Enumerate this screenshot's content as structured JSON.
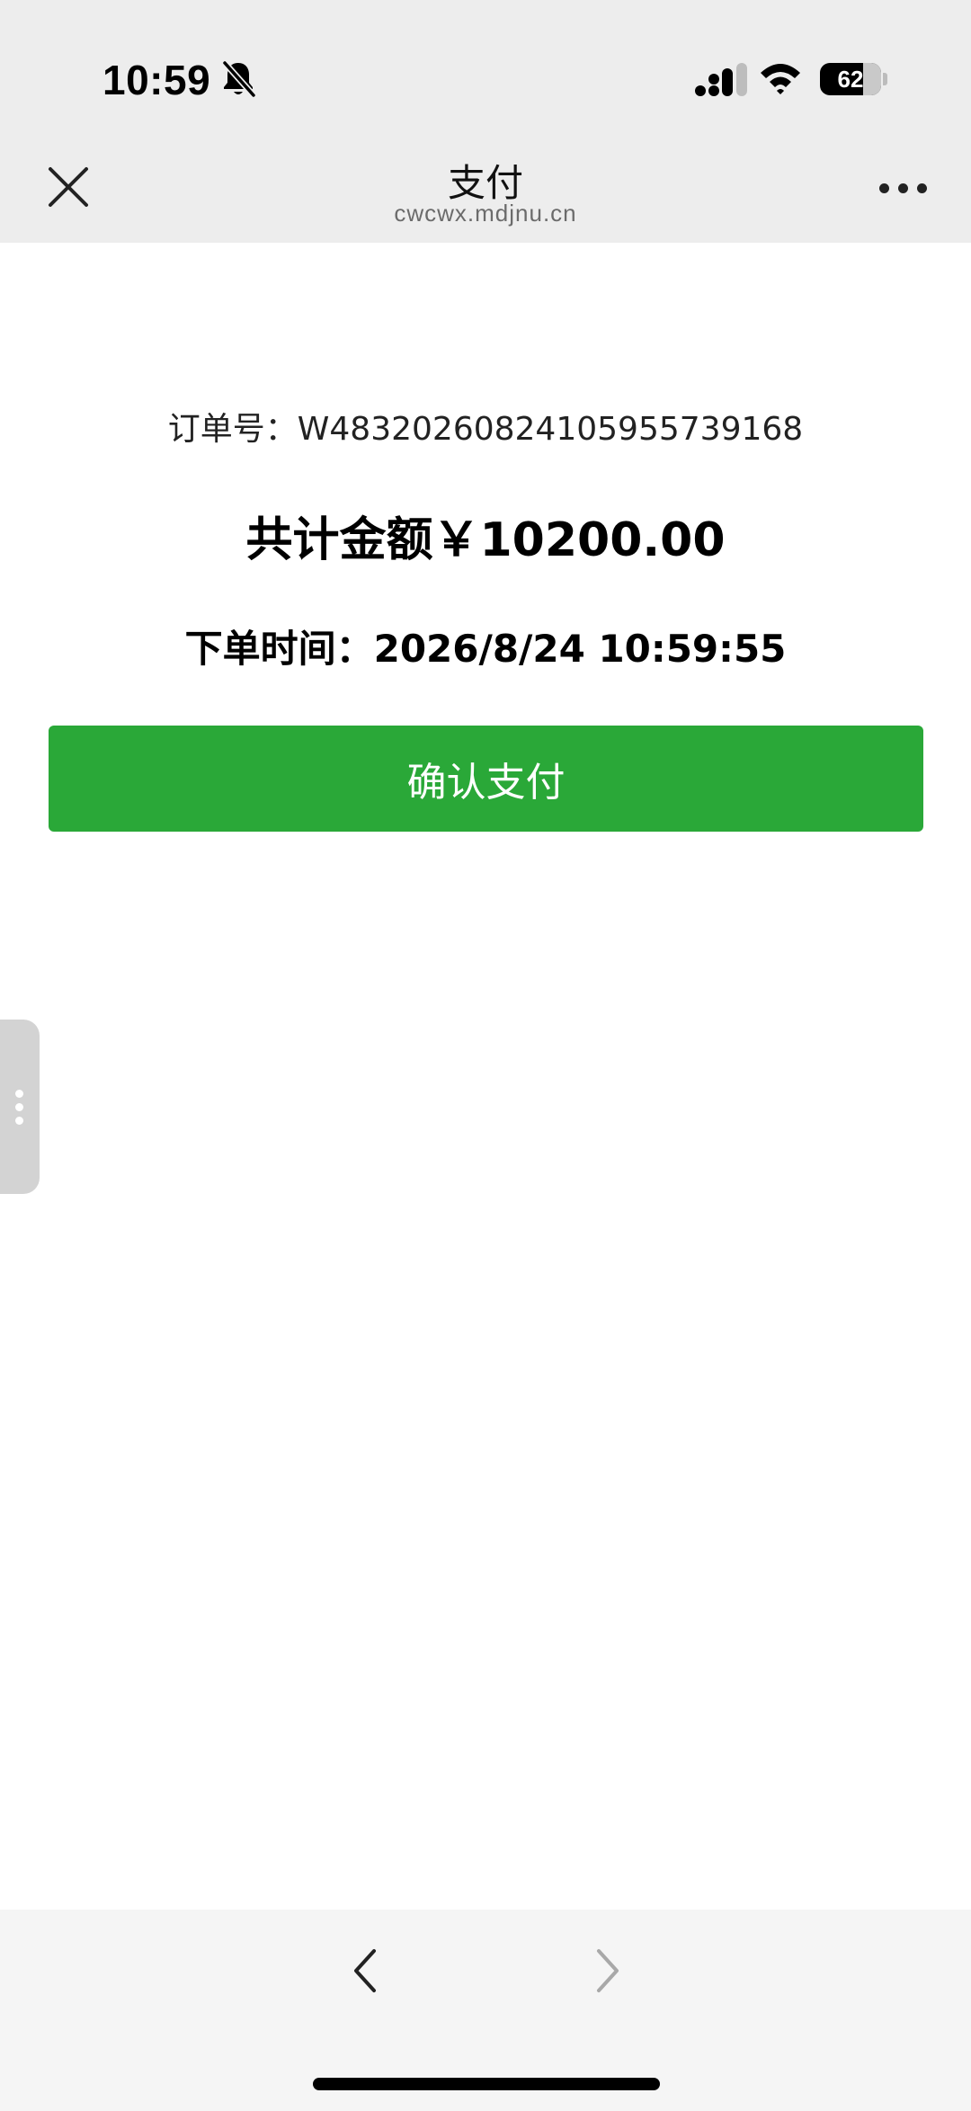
{
  "status_bar": {
    "time": "10:59",
    "battery_level": "62",
    "icons": [
      "bell-muted-icon",
      "cellular-signal-icon",
      "wifi-icon",
      "battery-icon"
    ]
  },
  "nav": {
    "title": "支付",
    "url": "cwcwx.mdjnu.cn",
    "close_icon": "close-icon",
    "more_icon": "more-icon"
  },
  "order": {
    "order_number": "订单号：W48320260824105955739168",
    "total": "共计金额￥10200.00",
    "order_time": "下单时间：2026/8/24 10:59:55"
  },
  "actions": {
    "confirm_pay_label": "确认支付"
  },
  "toolbar": {
    "back_icon": "chevron-left-icon",
    "forward_icon": "chevron-right-icon"
  },
  "colors": {
    "primary_green": "#2aa838",
    "header_bg": "#ededed",
    "toolbar_bg": "#f5f5f5"
  }
}
